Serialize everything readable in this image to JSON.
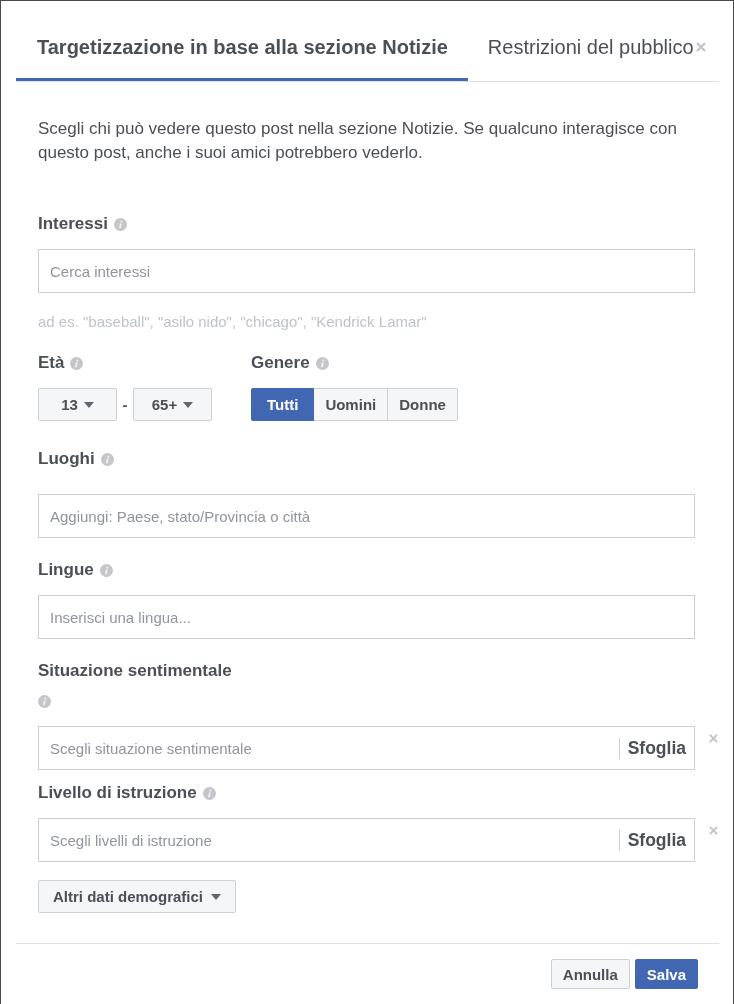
{
  "tabs": [
    {
      "label": "Targetizzazione in base alla sezione Notizie",
      "selected": true
    },
    {
      "label": "Restrizioni del pubblico",
      "selected": false
    }
  ],
  "description": "Scegli chi può vedere questo post nella sezione Notizie. Se qualcuno interagisce con questo post, anche i suoi amici potrebbero vederlo.",
  "sections": [
    {
      "kind": "text_input",
      "label": "Interessi",
      "info": true,
      "info_wrapped": false,
      "placeholder": "Cerca interessi",
      "hint": "ad es. \"baseball\", \"asilo nido\", \"chicago\", \"Kendrick Lamar\""
    },
    {
      "kind": "demographics",
      "age": {
        "label": "Età",
        "info": true,
        "from": "13",
        "separator": "-",
        "to": "65+"
      },
      "gender": {
        "label": "Genere",
        "info": true,
        "options": [
          {
            "label": "Tutti",
            "selected": true
          },
          {
            "label": "Uomini",
            "selected": false
          },
          {
            "label": "Donne",
            "selected": false
          }
        ]
      }
    },
    {
      "kind": "text_input",
      "label": "Luoghi",
      "info": true,
      "info_wrapped": false,
      "placeholder": "Aggiungi: Paese, stato/Provincia o città"
    },
    {
      "kind": "text_input",
      "label": "Lingue",
      "info": true,
      "info_wrapped": false,
      "placeholder": "Inserisci una lingua..."
    },
    {
      "kind": "browse_input",
      "label": "Situazione sentimentale",
      "info": true,
      "info_wrapped": true,
      "placeholder": "Scegli situazione sentimentale",
      "browse": "Sfoglia",
      "removable": true
    },
    {
      "kind": "browse_input",
      "label": "Livello di istruzione",
      "info": true,
      "info_wrapped": false,
      "placeholder": "Scegli livelli di istruzione",
      "browse": "Sfoglia",
      "removable": true
    }
  ],
  "more_button": {
    "label": "Altri dati demografici"
  },
  "footer_buttons": [
    {
      "label": "Annulla",
      "kind": "secondary"
    },
    {
      "label": "Salva",
      "kind": "primary"
    }
  ]
}
